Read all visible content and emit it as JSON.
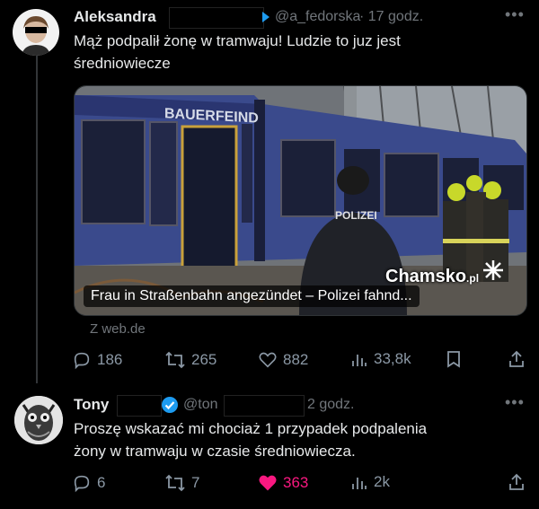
{
  "post": {
    "author_name": "Aleksandra",
    "handle": "@a_fedorska",
    "time": "· 17 godz.",
    "text_line1": "Mąż podpalił żonę w tramwaju! Ludzie to juz jest",
    "text_line2": "średniowiecze",
    "card": {
      "tram_banner": "BAUERFEIND",
      "police_label": "POLIZEI",
      "headline": "Frau in Straßenbahn angezündet – Polizei fahnd...",
      "watermark": "Chamsko",
      "watermark_suffix": ".pl",
      "source": "Z web.de"
    },
    "actions": {
      "replies": "186",
      "retweets": "265",
      "likes": "882",
      "views": "33,8k"
    }
  },
  "reply": {
    "author_name": "Tony",
    "handle": "@ton",
    "time": "2 godz.",
    "text_line1": "Proszę wskazać mi chociaż 1 przypadek podpalenia",
    "text_line2": "żony w tramwaju w czasie średniowiecza.",
    "actions": {
      "replies": "6",
      "retweets": "7",
      "likes": "363",
      "views": "2k"
    }
  },
  "colors": {
    "background": "#000000",
    "text": "#e7e9ea",
    "muted": "#71767b",
    "verified": "#1d9bf0",
    "liked": "#f91880"
  },
  "icons": [
    "more-icon",
    "reply-icon",
    "retweet-icon",
    "like-icon",
    "views-icon",
    "bookmark-icon",
    "share-icon",
    "verified-icon"
  ]
}
